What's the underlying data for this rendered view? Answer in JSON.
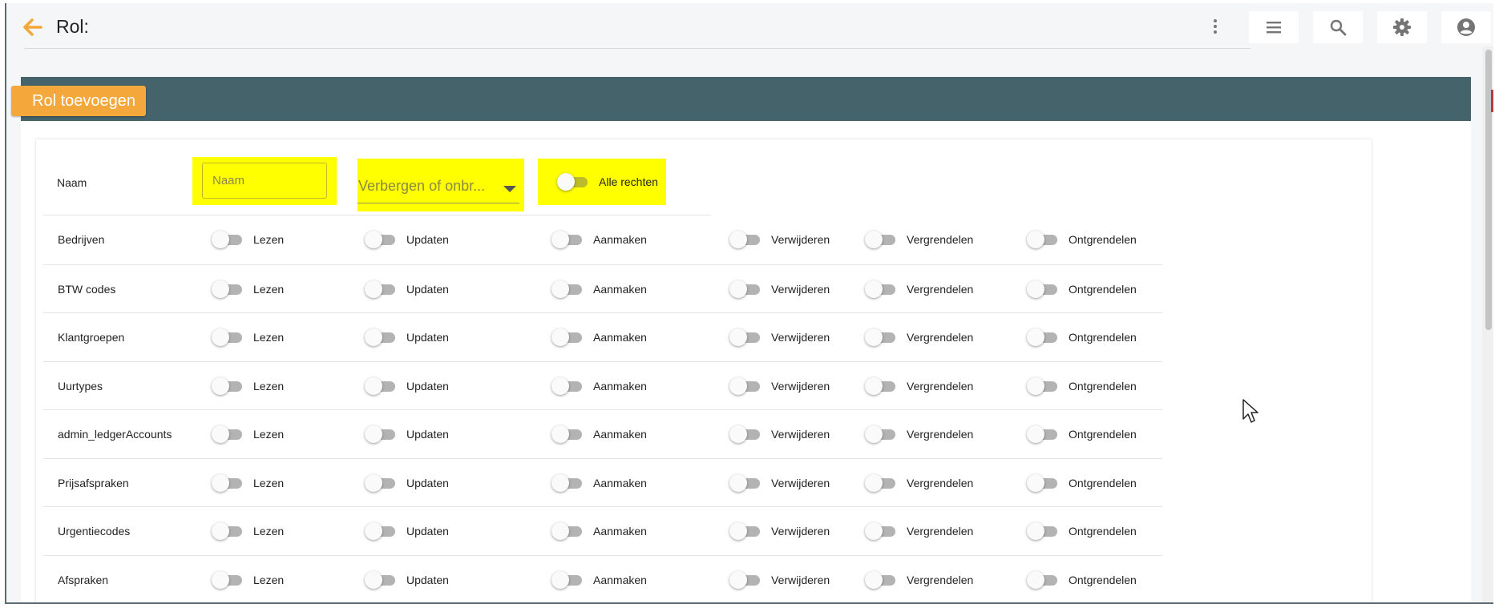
{
  "header": {
    "title": "Rol:",
    "buttons": [
      {
        "name": "menu-button",
        "icon": "menu-icon"
      },
      {
        "name": "search-button",
        "icon": "search-icon"
      },
      {
        "name": "settings-button",
        "icon": "gear-icon"
      },
      {
        "name": "account-button",
        "icon": "account-circle-icon"
      }
    ]
  },
  "card": {
    "badge_label": "Rol toevoegen"
  },
  "form": {
    "name_label": "Naam",
    "name_placeholder": "Naam",
    "visibility_select_value": "Verbergen of onbr...",
    "all_rights_label": "Alle rechten",
    "all_rights_on": false
  },
  "permission_labels": [
    "Lezen",
    "Updaten",
    "Aanmaken",
    "Verwijderen",
    "Vergrendelen",
    "Ontgrendelen"
  ],
  "permission_rows": [
    {
      "label": "Bedrijven"
    },
    {
      "label": "BTW codes"
    },
    {
      "label": "Klantgroepen"
    },
    {
      "label": "Uurtypes"
    },
    {
      "label": "admin_ledgerAccounts"
    },
    {
      "label": "Prijsafspraken"
    },
    {
      "label": "Urgentiecodes"
    },
    {
      "label": "Afspraken"
    }
  ],
  "colors": {
    "accent_orange": "#f4a73b",
    "card_header": "#44636b",
    "highlight": "#ffff00"
  }
}
